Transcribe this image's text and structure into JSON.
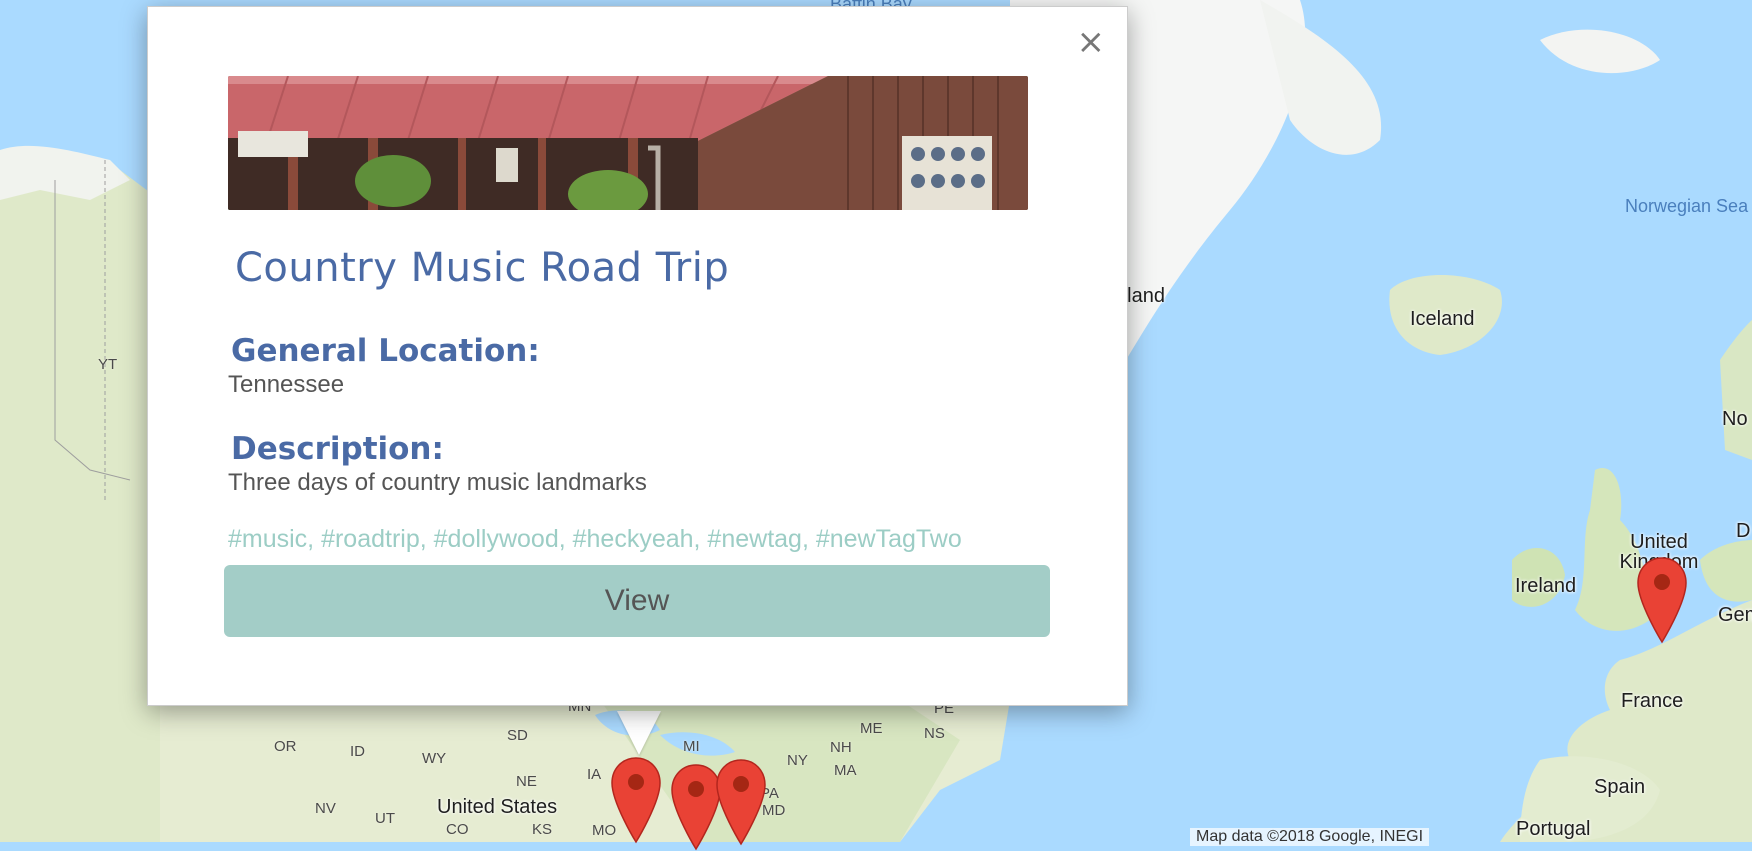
{
  "map": {
    "labels": {
      "greenland_partial": "nland",
      "iceland": "Iceland",
      "norwegian_sea": "Norwegian Sea",
      "yukon": "YT",
      "united_kingdom": "United Kingdom",
      "ireland": "Ireland",
      "germany_partial": "Gem",
      "norway_partial": "No",
      "denmark_partial": "D",
      "france": "France",
      "spain": "Spain",
      "portugal": "Portugal",
      "united_states": "United States",
      "baffin_partial": "Baffin Bay",
      "states": [
        "MN",
        "SD",
        "OR",
        "ID",
        "WY",
        "NE",
        "IA",
        "MI",
        "NY",
        "PA",
        "MD",
        "NV",
        "UT",
        "CO",
        "KS",
        "MO",
        "ME",
        "NH",
        "MA",
        "NS",
        "PE"
      ]
    },
    "attribution": "Map data ©2018 Google, INEGI",
    "colors": {
      "water": "#aadaff",
      "land": "#e9efd8",
      "land_green": "#cfe3b4",
      "ice": "#f5f7f7",
      "marker": "#e94235",
      "marker_dark": "#a52714"
    }
  },
  "popup": {
    "close_label": "×",
    "image_alt": "Country store with red roof",
    "title": "Country Music Road Trip",
    "general_location_label": "General Location:",
    "general_location": "Tennessee",
    "description_label": "Description:",
    "description": "Three days of country music landmarks",
    "tags": "#music, #roadtrip, #dollywood, #heckyeah, #newtag, #newTagTwo",
    "view_label": "View",
    "colors": {
      "heading": "#4a6aa5",
      "tags": "#9ccdc5",
      "button": "#a3cdc7"
    }
  }
}
